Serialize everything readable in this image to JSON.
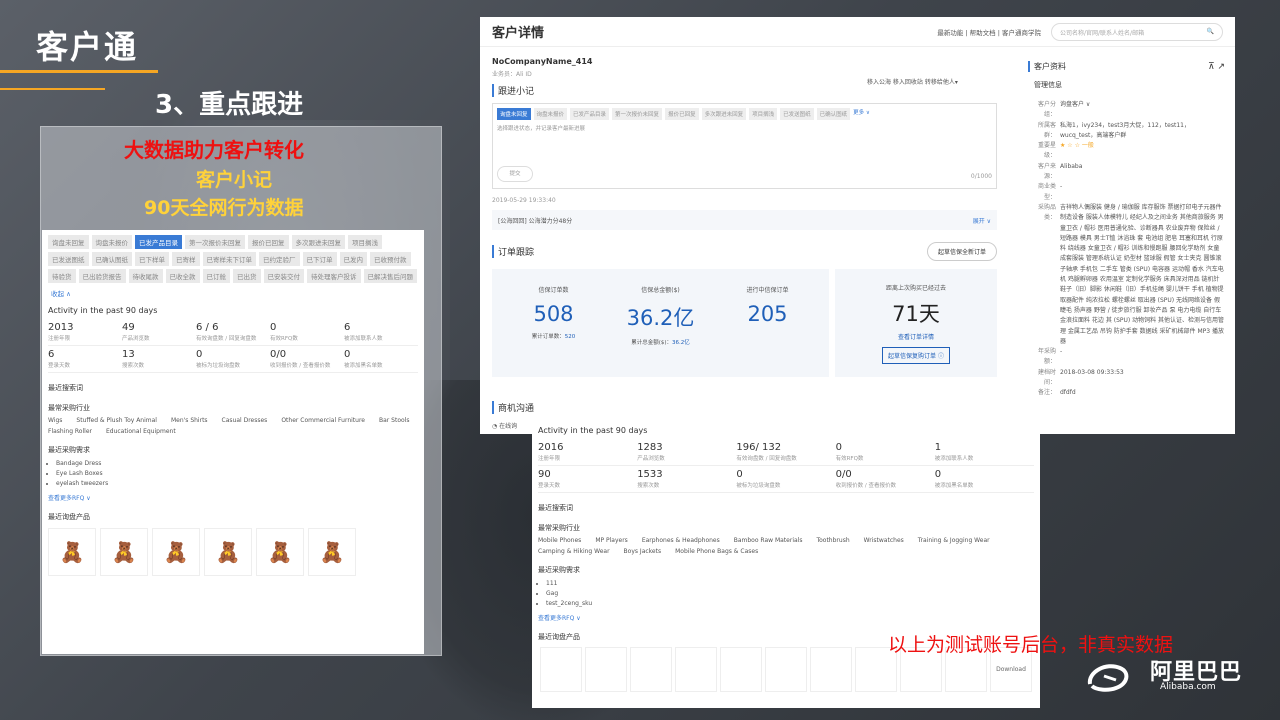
{
  "slide": {
    "title": "客户通",
    "subtitle": "3、重点跟进",
    "heading_red": "大数据助力客户转化",
    "heading_y1": "客户小记",
    "heading_y2": "90天全网行为数据",
    "footnote": "以上为测试账号后台，非真实数据",
    "brand_cn": "阿里巴巴",
    "brand_en": "Alibaba.com"
  },
  "left_shot": {
    "tags": [
      {
        "label": "询盘未回复",
        "active": false
      },
      {
        "label": "询盘未报价",
        "active": false
      },
      {
        "label": "已发产品目录",
        "active": true
      },
      {
        "label": "第一次报价未回复",
        "active": false
      },
      {
        "label": "报价已回复",
        "active": false
      },
      {
        "label": "多次跟进未回复",
        "active": false
      },
      {
        "label": "项目搁浅",
        "active": false
      },
      {
        "label": "已发送图纸",
        "active": false
      },
      {
        "label": "已确认图纸",
        "active": false
      },
      {
        "label": "已下样单",
        "active": false
      },
      {
        "label": "已寄样",
        "active": false
      },
      {
        "label": "已寄样未下订单",
        "active": false
      },
      {
        "label": "已约定验厂",
        "active": false
      },
      {
        "label": "已下订单",
        "active": false
      },
      {
        "label": "已发内",
        "active": false
      },
      {
        "label": "已收预付款",
        "active": false
      },
      {
        "label": "待验货",
        "active": false
      },
      {
        "label": "已出验货报告",
        "active": false
      },
      {
        "label": "待收尾款",
        "active": false
      },
      {
        "label": "已收全款",
        "active": false
      },
      {
        "label": "已订舱",
        "active": false
      },
      {
        "label": "已出货",
        "active": false
      },
      {
        "label": "已安装交付",
        "active": false
      },
      {
        "label": "待处理客户投诉",
        "active": false
      },
      {
        "label": "已解决售后问题",
        "active": false
      }
    ],
    "collapse": "收起 ∧",
    "activity_title": "Activity in the past 90 days",
    "stats": [
      {
        "v": "2013",
        "l": "注册年限"
      },
      {
        "v": "49",
        "l": "产品浏览数"
      },
      {
        "v": "6 / 6",
        "l": "有效询盘数 / 回复询盘数"
      },
      {
        "v": "0",
        "l": "有效RFQ数"
      },
      {
        "v": "6",
        "l": "被添加联系人数"
      },
      {
        "v": "6",
        "l": "登录天数"
      },
      {
        "v": "13",
        "l": "搜索次数"
      },
      {
        "v": "0",
        "l": "被标为垃圾询盘数"
      },
      {
        "v": "0/0",
        "l": "收到报价数 / 查看报价数"
      },
      {
        "v": "0",
        "l": "被添加黑名单数"
      }
    ],
    "recent_search": "最近搜索词",
    "industry_title": "最常采购行业",
    "industries": [
      "Wigs",
      "Stuffed & Plush Toy Animal",
      "Men's Shirts",
      "Casual Dresses",
      "Other Commercial Furniture",
      "Bar Stools",
      "Flashing Roller",
      "Educational Equipment"
    ],
    "req_title": "最近采购需求",
    "reqs": [
      "Bandage Dress",
      "Eye Lash Boxes",
      "eyelash tweezers"
    ],
    "more_rfq": "查看更多RFQ ∨",
    "products_title": "最近询盘产品",
    "products": [
      "🧸",
      "🧸",
      "🧸",
      "🧸",
      "🧸",
      "🧸"
    ]
  },
  "rt": {
    "title": "客户详情",
    "links": "最新功能 | 帮助文档 | 客户通商学院",
    "search_placeholder": "公司名称/官网/联系人姓名/邮箱",
    "company": "NoCompanyName_414",
    "sales": "业务员：Ali ID",
    "actions": "移入公海   移入回收站   转移给他人▾",
    "note_title": "跟进小记",
    "note_tags": [
      {
        "label": "询盘未回复",
        "active": true
      },
      {
        "label": "询盘未报价",
        "active": false
      },
      {
        "label": "已发产品目录",
        "active": false
      },
      {
        "label": "第一次报价未回复",
        "active": false
      },
      {
        "label": "报价已回复",
        "active": false
      },
      {
        "label": "多次跟进未回复",
        "active": false
      },
      {
        "label": "项目搁浅",
        "active": false
      },
      {
        "label": "已发送图纸",
        "active": false
      },
      {
        "label": "已确认图纸",
        "active": false
      }
    ],
    "note_more": "更多 ∨",
    "note_placeholder": "选择跟进状态，并记录客户最新进展",
    "submit": "提交",
    "counter": "0/1000",
    "log_time": "2019-05-29 19:33:40",
    "log_text": "[公海回回] 公海潜力分48分",
    "expand": "展开 ∨",
    "order_title": "订单跟踪",
    "order_btn": "起草信保全新订单",
    "kpis": [
      {
        "l": "信保订单数",
        "v": "508",
        "s": "累计订单数：",
        "sv": "520"
      },
      {
        "l": "信保总金额($)",
        "v": "36.2亿",
        "s": "累计总金额($)：",
        "sv": "36.2亿"
      },
      {
        "l": "进行中信保订单",
        "v": "205",
        "s": "",
        "sv": ""
      }
    ],
    "last_label": "距离上次购买已经过去",
    "last_value": "71天",
    "last_link": "查看订单详情",
    "last_btn": "起草信保复购订单",
    "biz_title": "商机沟通",
    "online": "在线询",
    "side_title": "客户资料",
    "side_tab": "管理信息",
    "info": [
      {
        "k": "客户分组：",
        "v": "询盘客户 ∨"
      },
      {
        "k": "所属客群：",
        "v": "私海1，ivy234，test3月大促，112，test11，wucq_test，高端客户群"
      },
      {
        "k": "重要星级：",
        "v": "★ ☆ ☆ 一般"
      },
      {
        "k": "客户来源：",
        "v": "Alibaba"
      },
      {
        "k": "商业类型：",
        "v": "-"
      },
      {
        "k": "采购品类：",
        "v": "吉祥物人偶服装 健身 / 瑜伽服 库存服饰 票据打印电子元器件制造设备 服装人体模特儿 经纪人及之间业务 其他商旅服务 男童卫衣 / 帽衫 医用普通化验、诊断器具 农业废弃物 保险丝 / 短路器 模具 男士T恤 沐浴珠 套 电池组 肥皂 耳塞和耳机 行原料 绕线器 女童卫衣 / 帽衫 训练和慢跑服 腰回化学助剂 女童成套服装 管理系统认证 奶型材 篮球服 假管 女士夹克 圆锥滚子轴承 手机包 二手车 管类 (SPU) 电容器 运动帽 香水 汽车电机 鸡腿孵卵器 农用温室 定制化学服务 床具深对用品 链机针 鞋子（旧）脚影 休闲鞋（旧）手机挂绳 婴儿饼干 手机 植物提取器配件 纯浓拉松 螺栓螺丝 取出器 (SPU) 无线网络设备 假睫毛 扬声器 野营 / 徒步旅行服 卸妆产品 泵 电力电缆 自行车 金浪拉面料 花边 其 (SPU) 动物饲料 其他认证、检测与信用管理 金属工艺品 吊钩 防护手套 数据线 采矿机械部件 MP3 播放器"
      },
      {
        "k": "年采购额：",
        "v": "-"
      },
      {
        "k": "建档时间：",
        "v": "2018-03-08 09:33:53"
      },
      {
        "k": "备注：",
        "v": "dfdfd"
      }
    ]
  },
  "rb": {
    "activity_title": "Activity in the past 90 days",
    "stats": [
      {
        "v": "2016",
        "l": "注册年限"
      },
      {
        "v": "1283",
        "l": "产品浏览数"
      },
      {
        "v": "196/ 132",
        "l": "有效询盘数 / 回复询盘数"
      },
      {
        "v": "0",
        "l": "有效RFQ数"
      },
      {
        "v": "1",
        "l": "被添加联系人数"
      },
      {
        "v": "90",
        "l": "登录天数"
      },
      {
        "v": "1533",
        "l": "搜索次数"
      },
      {
        "v": "0",
        "l": "被标为垃圾询盘数"
      },
      {
        "v": "0/0",
        "l": "收到报价数 / 查看报价数"
      },
      {
        "v": "0",
        "l": "被添加黑名单数"
      }
    ],
    "recent_search": "最近搜索词",
    "industry_title": "最常采购行业",
    "industries": [
      "Mobile Phones",
      "MP Players",
      "Earphones & Headphones",
      "Bamboo Raw Materials",
      "Toothbrush",
      "Wristwatches",
      "Training & Jogging Wear",
      "Camping & Hiking Wear",
      "Boys Jackets",
      "Mobile Phone Bags & Cases"
    ],
    "req_title": "最近采购需求",
    "reqs": [
      "111",
      "Gag",
      "test_2ceng_sku"
    ],
    "more_rfq": "查看更多RFQ ∨",
    "products_title": "最近询盘产品",
    "thumb_labels": [
      "",
      "",
      "",
      "",
      "",
      "",
      "",
      "",
      "",
      "",
      "Download"
    ]
  }
}
